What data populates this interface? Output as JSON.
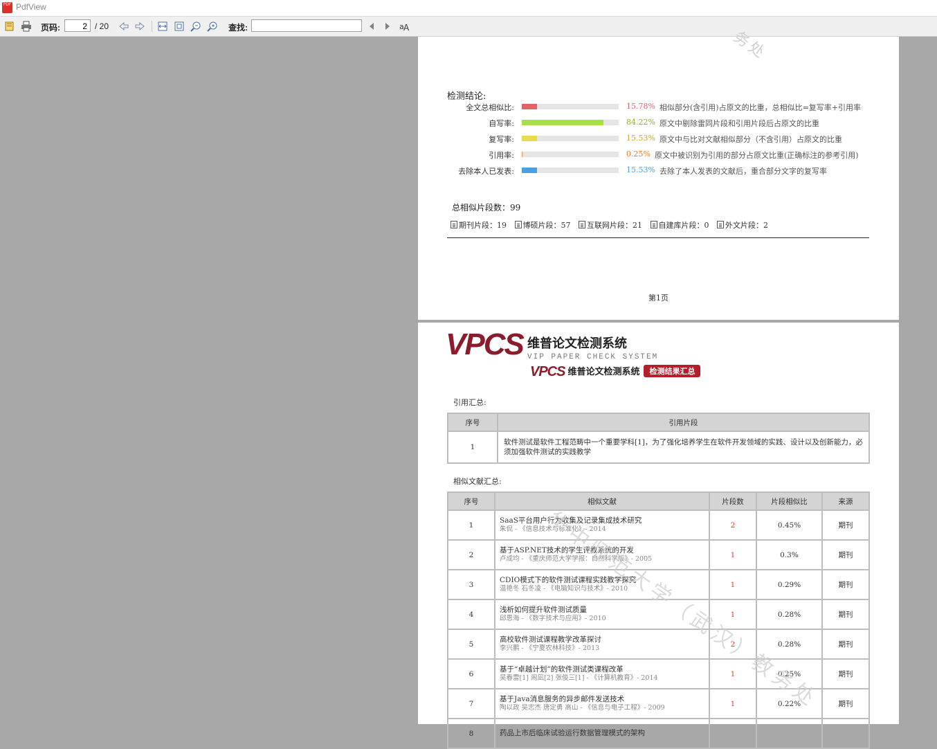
{
  "window": {
    "title": "PdfView",
    "app_icon": "pdf-app-icon"
  },
  "toolbar": {
    "page_label": "页码:",
    "page_value": "2",
    "page_total": "/ 20",
    "find_label": "查找:",
    "find_value": ""
  },
  "page1": {
    "watermark": "务处",
    "conclusion_title": "检测结论:",
    "metrics": [
      {
        "label": "全文总相似比:",
        "value": 15.78,
        "pct": "15.78%",
        "color": "#e06666",
        "desc": "相似部分(含引用)占原文的比重，总相似比=复写率+引用率"
      },
      {
        "label": "自写率:",
        "value": 84.22,
        "pct": "84.22%",
        "color": "#a5e04a",
        "pct_color": "#8ab22e",
        "desc": "原文中剔除雷同片段和引用片段后占原文的比重"
      },
      {
        "label": "复写率:",
        "value": 15.53,
        "pct": "15.53%",
        "color": "#e8dc4a",
        "pct_color": "#c9a82b",
        "desc": "原文中与比对文献相似部分（不含引用）占原文的比重"
      },
      {
        "label": "引用率:",
        "value": 0.25,
        "pct": "0.25%",
        "color": "#e8a04a",
        "pct_color": "#e07b2a",
        "desc": "原文中被识别为引用的部分占原文比重(正确标注的参考引用)"
      },
      {
        "label": "去除本人已发表:",
        "value": 15.53,
        "pct": "15.53%",
        "color": "#4aa0e0",
        "pct_color": "#4aa0e0",
        "desc": "去除了本人发表的文献后，重合部分文字的复写率"
      }
    ],
    "total_segments": "总相似片段数：99",
    "segments": [
      {
        "label": "期刊片段：19"
      },
      {
        "label": "博硕片段：57"
      },
      {
        "label": "互联网片段：21"
      },
      {
        "label": "自建库片段：0"
      },
      {
        "label": "外文片段：2"
      }
    ],
    "page_number": "第1页"
  },
  "page2": {
    "logo_big": "VPCS",
    "logo_cn": "维普论文检测系统",
    "logo_en": "VIP PAPER CHECK SYSTEM",
    "sub_logo_mini": "VPCS",
    "sub_logo_cn": "维普论文检测系统",
    "badge": "检测结果汇总",
    "cite_title": "引用汇总:",
    "cite_headers": [
      "序号",
      "引用片段"
    ],
    "cite_rows": [
      {
        "no": "1",
        "text": "软件测试是软件工程范畴中一个重要学科[1]，为了强化培养学生在软件开发领域的实践、设计以及创新能力，必须加强软件测试的实践教学"
      }
    ],
    "sim_title": "相似文献汇总:",
    "sim_headers": [
      "序号",
      "相似文献",
      "片段数",
      "片段相似比",
      "来源"
    ],
    "sim_rows": [
      {
        "no": "1",
        "title": "SaaS平台用户行为收集及记录集成技术研究",
        "meta": "朱侃 - 《信息技术与标准化》- 2014",
        "count": "2",
        "ratio": "0.45%",
        "source": "期刊"
      },
      {
        "no": "2",
        "title": "基于ASP.NET技术的学生评教系统的开发",
        "meta": "卢成均 - 《重庆师范大学学报：自然科学版》- 2005",
        "count": "1",
        "ratio": "0.3%",
        "source": "期刊"
      },
      {
        "no": "3",
        "title": "CDIO模式下的软件测试课程实践教学探究",
        "meta": "温艳冬 石冬凌 - 《电脑知识与技术》- 2010",
        "count": "1",
        "ratio": "0.29%",
        "source": "期刊"
      },
      {
        "no": "4",
        "title": "浅析如何提升软件测试质量",
        "meta": "邱恩海 - 《数字技术与应用》- 2010",
        "count": "1",
        "ratio": "0.28%",
        "source": "期刊"
      },
      {
        "no": "5",
        "title": "高校软件测试课程教学改革探讨",
        "meta": "李兴鹏 - 《宁夏农林科技》- 2013",
        "count": "2",
        "ratio": "0.28%",
        "source": "期刊"
      },
      {
        "no": "6",
        "title": "基于“卓越计划”的软件测试类课程改革",
        "meta": "吴春雷[1] 闹凪[2] 张俊三[1] - 《计算机教育》- 2014",
        "count": "1",
        "ratio": "0.25%",
        "source": "期刊"
      },
      {
        "no": "7",
        "title": "基于Java消息服务的异步邮件发送技术",
        "meta": "陶以政 吴志杰 唐定勇 高山 - 《信息与电子工程》- 2009",
        "count": "1",
        "ratio": "0.22%",
        "source": "期刊"
      },
      {
        "no": "8",
        "title": "药品上市后临床试验运行数据管理模式的架构",
        "meta": "",
        "count": "",
        "ratio": "",
        "source": ""
      }
    ],
    "watermark": "华中师范大学（武汉）教务处"
  }
}
